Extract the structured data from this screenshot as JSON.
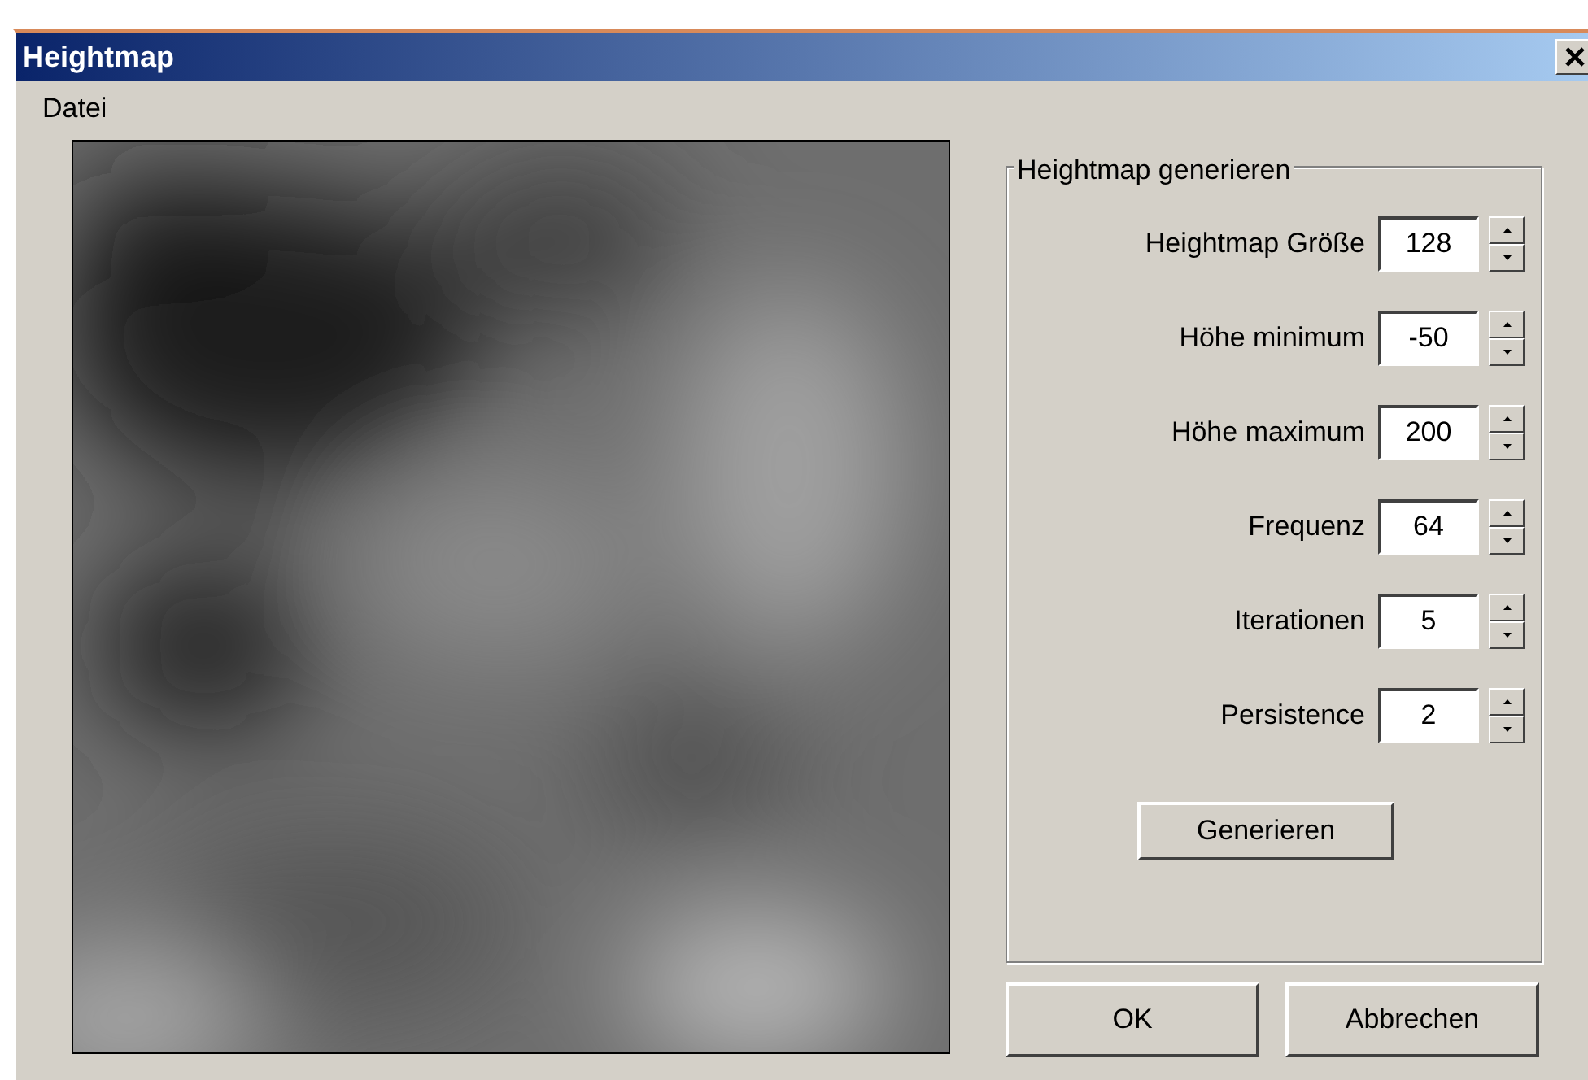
{
  "window": {
    "title": "Heightmap"
  },
  "menu": [
    {
      "label": "Datei"
    }
  ],
  "group": {
    "title": "Heightmap generieren",
    "fields": [
      {
        "label": "Heightmap Größe",
        "value": "128"
      },
      {
        "label": "Höhe minimum",
        "value": "-50"
      },
      {
        "label": "Höhe maximum",
        "value": "200"
      },
      {
        "label": "Frequenz",
        "value": "64"
      },
      {
        "label": "Iterationen",
        "value": "5"
      },
      {
        "label": "Persistence",
        "value": "2"
      }
    ],
    "action": "Generieren"
  },
  "buttons": [
    "OK",
    "Abbrechen"
  ]
}
